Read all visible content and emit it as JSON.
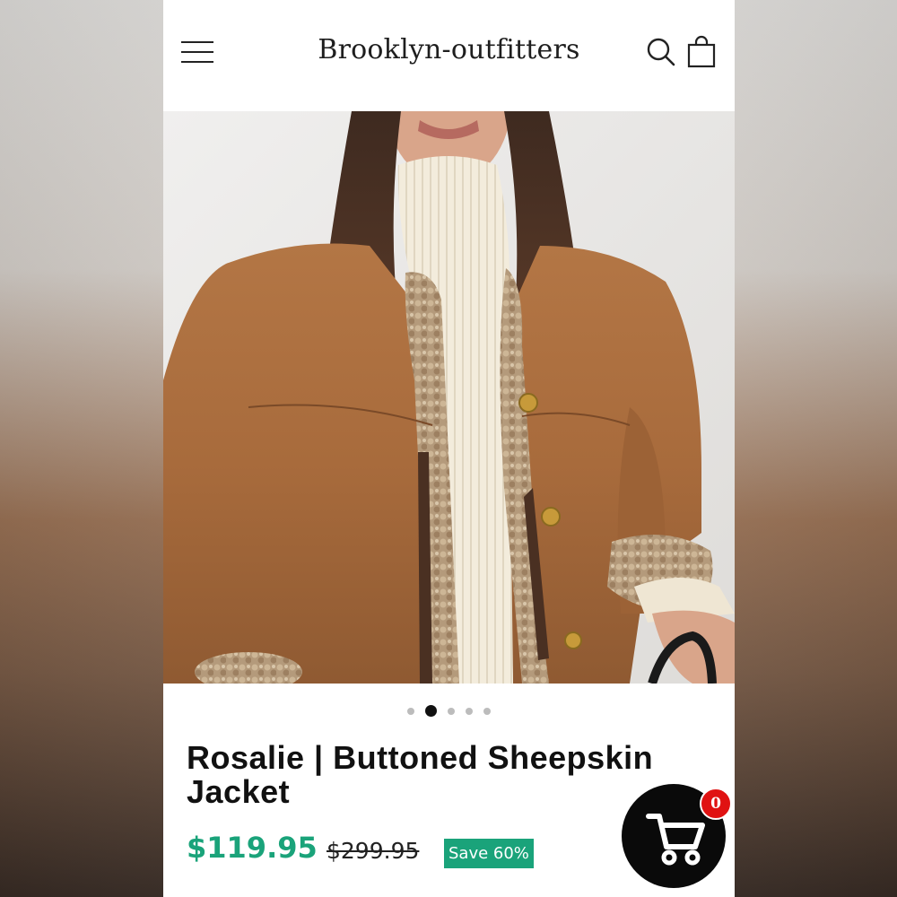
{
  "header": {
    "brand": "Brooklyn-outfitters",
    "menu_icon": "hamburger-menu-icon",
    "search_icon": "search-icon",
    "bag_icon": "shopping-bag-icon"
  },
  "gallery": {
    "image_alt": "Model wearing a tan suede sheepskin jacket over a cream ribbed turtleneck",
    "slide_count": 5,
    "active_slide": 2
  },
  "product": {
    "title": "Rosalie | Buttoned Sheepskin Jacket",
    "price": "$119.95",
    "compare_price": "$299.95",
    "save_badge": "Save 60%"
  },
  "cart": {
    "icon": "cart-icon",
    "count": "0"
  },
  "colors": {
    "accent_green": "#1aa37a",
    "badge_red": "#e01212",
    "fab_black": "#0a0a0a"
  }
}
